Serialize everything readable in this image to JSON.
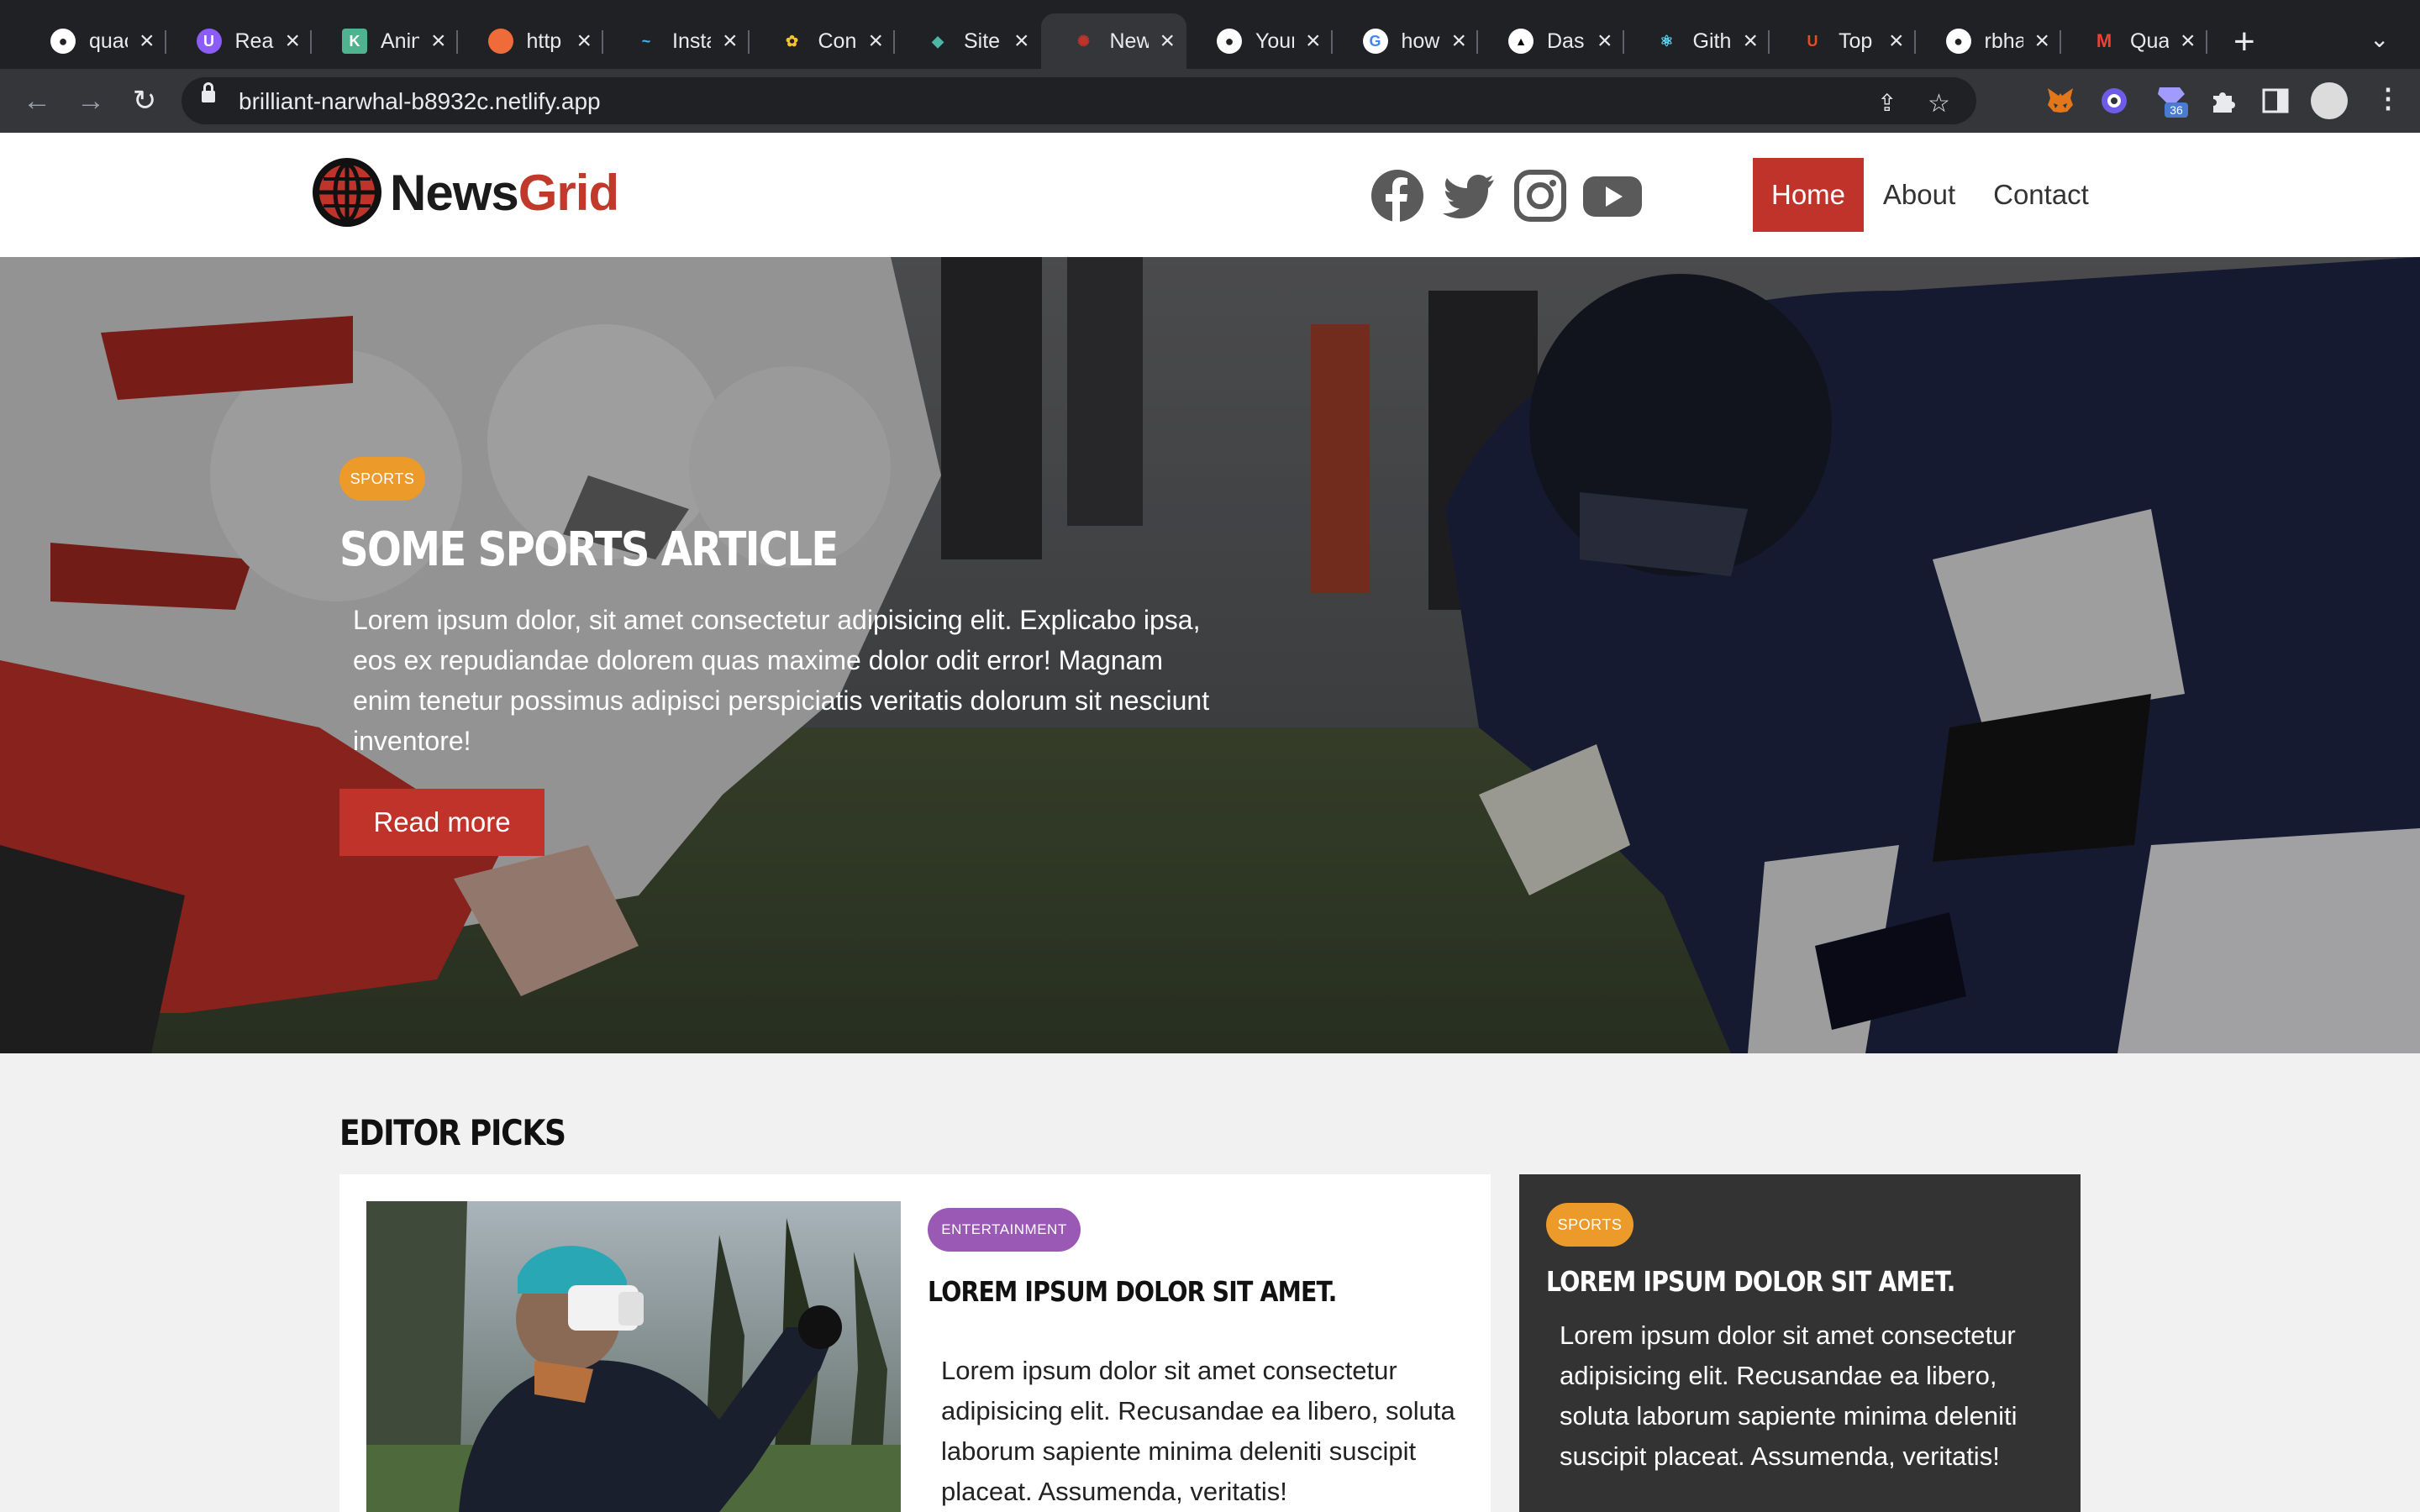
{
  "browser": {
    "tabs": [
      {
        "title": "quac",
        "icon": "github-icon",
        "color": "#ffffff",
        "glyph": ""
      },
      {
        "title": "Read",
        "icon": "ublock-icon",
        "color": "#8b5cf6",
        "glyph": "U"
      },
      {
        "title": "Anin",
        "icon": "k-icon",
        "color": "#4fb38f",
        "glyph": "K"
      },
      {
        "title": "http",
        "icon": "postman-icon",
        "color": "#ef6c3a",
        "glyph": ""
      },
      {
        "title": "Insta",
        "icon": "tailwind-icon",
        "color": "#38bdf8",
        "glyph": "~"
      },
      {
        "title": "Con",
        "icon": "flower-icon",
        "color": "#f4c430",
        "glyph": "✿"
      },
      {
        "title": "Site",
        "icon": "diamond-icon",
        "color": "#4db6a4",
        "glyph": "◆"
      },
      {
        "title": "New",
        "icon": "bug-icon",
        "color": "#c0332b",
        "glyph": "✺"
      },
      {
        "title": "Your",
        "icon": "github-icon",
        "color": "#ffffff",
        "glyph": ""
      },
      {
        "title": "how",
        "icon": "google-icon",
        "color": "#ffffff",
        "glyph": "G"
      },
      {
        "title": "Dash",
        "icon": "vercel-icon",
        "color": "#ffffff",
        "glyph": "▲"
      },
      {
        "title": "Gith",
        "icon": "react-icon",
        "color": "#61dafb",
        "glyph": "⚛"
      },
      {
        "title": "Top",
        "icon": "u-icon",
        "color": "#e44d26",
        "glyph": "U"
      },
      {
        "title": "rbha",
        "icon": "github-icon",
        "color": "#ffffff",
        "glyph": ""
      },
      {
        "title": "Qua",
        "icon": "gmail-icon",
        "color": "#ea4335",
        "glyph": "M"
      }
    ],
    "url": "brilliant-narwhal-b8932c.netlify.app",
    "extension_badge": "36"
  },
  "site": {
    "brand_part1": "News",
    "brand_part2": "Grid",
    "nav": {
      "home": "Home",
      "about": "About",
      "contact": "Contact"
    },
    "social": [
      "facebook-icon",
      "twitter-icon",
      "instagram-icon",
      "youtube-icon"
    ]
  },
  "hero": {
    "category": "Sports",
    "title": "Some Sports Article",
    "text": "Lorem ipsum dolor, sit amet consectetur adipisicing elit. Explicabo ipsa, eos ex repudiandae dolorem quas maxime dolor odit error! Magnam enim tenetur possimus adipisci perspiciatis veritatis dolorum sit nesciunt inventore!",
    "button": "Read more"
  },
  "editor_picks": {
    "heading": "Editor Picks",
    "main": {
      "category": "Entertainment",
      "title": "Lorem ipsum dolor sit amet.",
      "text": "Lorem ipsum dolor sit amet consectetur adipisicing elit. Recusandae ea libero, soluta laborum sapiente minima deleniti suscipit placeat. Assumenda, veritatis!"
    },
    "side": {
      "category": "Sports",
      "title": "Lorem ipsum dolor sit amet.",
      "text": "Lorem ipsum dolor sit amet consectetur adipisicing elit. Recusandae ea libero, soluta laborum sapiente minima deleniti suscipit placeat. Assumenda, veritatis!"
    }
  },
  "colors": {
    "brand_red": "#c0332b",
    "sports_badge": "#ec9a2a",
    "entertainment_badge": "#9b59b6",
    "dark_card": "#333333"
  }
}
